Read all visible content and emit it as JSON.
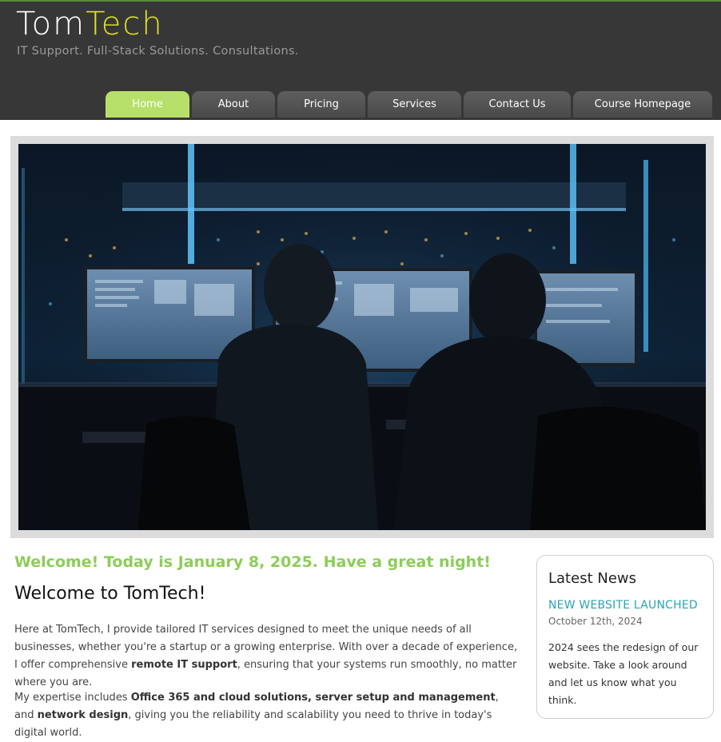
{
  "brand": {
    "part1": "Tom",
    "part2": "Tech",
    "tagline": "IT Support. Full-Stack Solutions. Consultations."
  },
  "nav": {
    "items": [
      {
        "label": "Home",
        "active": true
      },
      {
        "label": "About"
      },
      {
        "label": "Pricing"
      },
      {
        "label": "Services"
      },
      {
        "label": "Contact Us"
      },
      {
        "label": "Course Homepage"
      }
    ]
  },
  "hero": {
    "image": "it-operations-room-photo"
  },
  "main": {
    "greeting": "Welcome! Today is January 8, 2025. Have a great night!",
    "heading": "Welcome to TomTech!",
    "p1": {
      "a": "Here at TomTech, I provide tailored IT services designed to meet the unique needs of all businesses, whether you're a startup or a growing enterprise. With over a decade of experience, I offer comprehensive ",
      "b": "remote IT support",
      "c": ", ensuring that your systems run smoothly, no matter where you are."
    },
    "p2": {
      "a": "My expertise includes ",
      "b": "Office 365 and cloud solutions, server setup and management",
      "c": ", and ",
      "d": "network design",
      "e": ", giving you the reliability and scalability you need to thrive in today's digital world."
    }
  },
  "news": {
    "heading": "Latest News",
    "item_title": "NEW WEBSITE LAUNCHED",
    "item_date": "October 12th, 2024",
    "item_body": "2024 sees the redesign of our website. Take a look around and let us know what you think."
  },
  "colors": {
    "header_bg": "#373737",
    "accent_green": "#b7e06a",
    "logo_yellow": "#d9e021",
    "greeting_green": "#8ccd5a",
    "news_link": "#2aa3b3"
  }
}
